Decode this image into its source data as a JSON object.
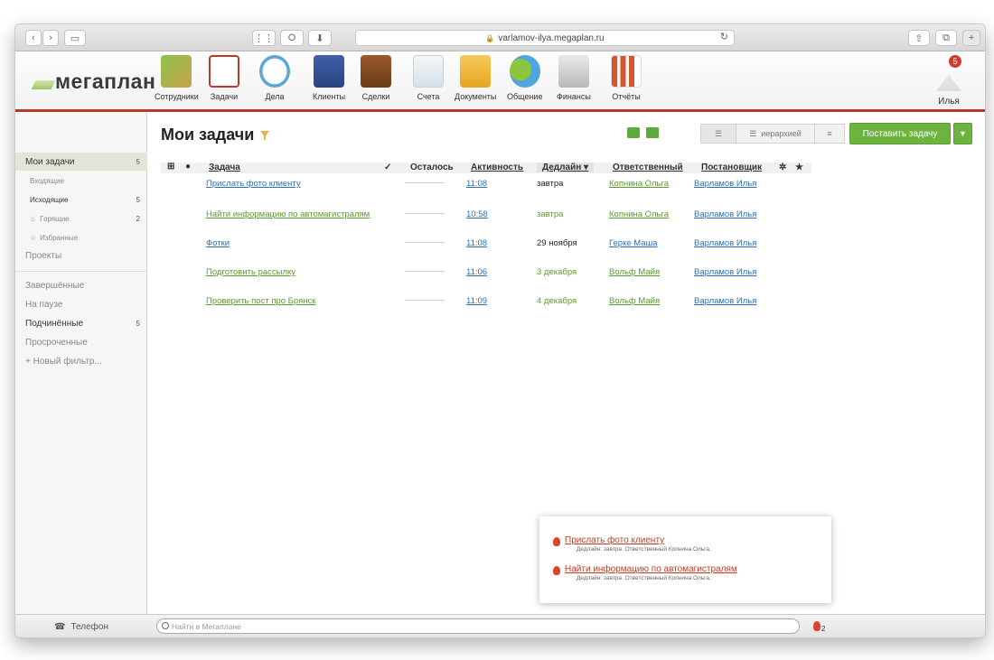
{
  "browser": {
    "url": "varlamov-ilya.megaplan.ru"
  },
  "app": {
    "logo": "мегаплан",
    "modules": [
      {
        "label": "Сотрудники",
        "icon": "employees-icon"
      },
      {
        "label": "Задачи",
        "icon": "tasks-icon"
      },
      {
        "label": "Дела",
        "icon": "clock-icon"
      },
      {
        "label": "Клиенты",
        "icon": "clients-icon"
      },
      {
        "label": "Сделки",
        "icon": "briefcase-icon"
      },
      {
        "label": "Счета",
        "icon": "invoice-icon"
      },
      {
        "label": "Документы",
        "icon": "folder-icon"
      },
      {
        "label": "Общение",
        "icon": "chat-icon"
      },
      {
        "label": "Финансы",
        "icon": "safe-icon"
      },
      {
        "label": "Отчёты",
        "icon": "reports-icon"
      }
    ],
    "user": {
      "name": "Илья",
      "badge": "5"
    },
    "colors": {
      "accent": "#b33a26",
      "green": "#6cb33f"
    }
  },
  "sidebar": {
    "my_tasks": {
      "label": "Мои задачи",
      "count": "5"
    },
    "incoming": "Входящие",
    "outgoing": {
      "label": "Исходящие",
      "count": "5"
    },
    "burning": {
      "label": "Горящие",
      "count": "2"
    },
    "favorites": "Избранные",
    "projects": "Проекты",
    "completed": "Завершённые",
    "paused": "На паузе",
    "subordinate": {
      "label": "Подчинённые",
      "count": "5"
    },
    "overdue": "Просроченные",
    "new_filter": "+ Новый фильтр..."
  },
  "main": {
    "title": "Мои задачи",
    "view_hierarchy": "иерархией",
    "add_task": "Поставить задачу",
    "columns": {
      "task": "Задача",
      "check": "✓",
      "remaining": "Осталось",
      "activity": "Активность",
      "deadline": "Дедлайн",
      "responsible": "Ответственный",
      "owner": "Постановщик"
    },
    "rows": [
      {
        "task": "Прислать фото клиенту",
        "activity": "11:08",
        "deadline": "завтра",
        "responsible": "Копнина Ольга",
        "owner": "Варламов Илья"
      },
      {
        "task": "Найти информацию по автомагистралям",
        "activity": "10:58",
        "deadline": "завтра",
        "responsible": "Копнина Ольга",
        "owner": "Варламов Илья"
      },
      {
        "task": "Фотки",
        "activity": "11:08",
        "deadline": "29 ноября",
        "responsible": "Герке Маша",
        "owner": "Варламов Илья"
      },
      {
        "task": "Подготовить рассылку",
        "activity": "11:06",
        "deadline": "3 декабря",
        "responsible": "Вольф Майя",
        "owner": "Варламов Илья"
      },
      {
        "task": "Проверить пост про Брянск",
        "activity": "11:09",
        "deadline": "4 декабря",
        "responsible": "Вольф Майя",
        "owner": "Варламов Илья"
      }
    ]
  },
  "popup": {
    "items": [
      {
        "title": "Прислать фото клиенту",
        "sub": "Дедлайн: завтра. Ответственный Копнина Ольга."
      },
      {
        "title": "Найти информацию по автомагистралям",
        "sub": "Дедлайн: завтра. Ответственный Копнина Ольга."
      }
    ]
  },
  "bottom": {
    "phone": "Телефон",
    "search_placeholder": "Найти в Мегаплане",
    "fire_count": "2"
  }
}
